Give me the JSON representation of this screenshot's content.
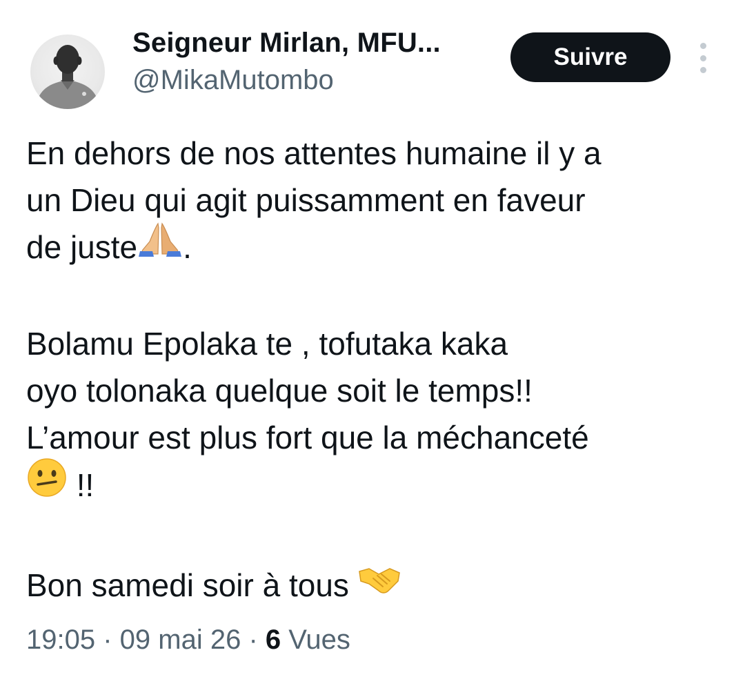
{
  "author": {
    "display_name": "Seigneur Mirlan, MFU...",
    "handle": "@MikaMutombo"
  },
  "actions": {
    "follow_label": "Suivre",
    "more_icon": "more-vertical-icon"
  },
  "tweet": {
    "lines": [
      "En dehors de nos attentes humaine il y a",
      "un Dieu qui agit puissamment en faveur",
      "de juste",
      ".",
      "Bolamu Epolaka te , tofutaka kaka",
      "oyo tolonaka quelque soit le temps!!",
      "L’amour est plus fort que la méchanceté",
      " !!",
      "Bon samedi soir à tous "
    ],
    "emojis": [
      "praying-hands-emoji",
      "neutral-face-emoji",
      "handshake-emoji"
    ]
  },
  "meta": {
    "time": "19:05",
    "sep1": " · ",
    "date": "09 mai 26",
    "sep2": " · ",
    "views_count": "6",
    "views_label": " Vues"
  },
  "colors": {
    "text": "#0f1419",
    "secondary": "#536471",
    "button_bg": "#0f1419",
    "button_text": "#ffffff"
  }
}
